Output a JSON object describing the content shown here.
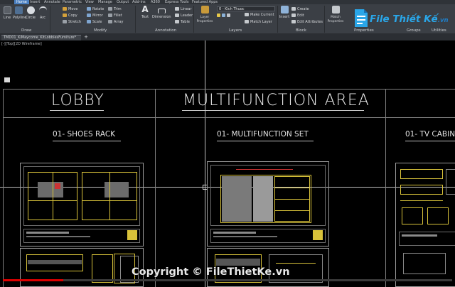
{
  "ribbon": {
    "tabs": [
      "Home",
      "Insert",
      "Annotate",
      "Parametric",
      "View",
      "Manage",
      "Output",
      "Add-ins",
      "A360",
      "Express Tools",
      "Featured Apps"
    ],
    "active_tab": "Home",
    "panels": {
      "draw": "Draw",
      "modify": "Modify",
      "annotation": "Annotation",
      "layers": "Layers",
      "block": "Block",
      "properties": "Properties",
      "groups": "Groups",
      "utilities": "Utilities"
    },
    "draw_tools": {
      "line": "Line",
      "polyline": "Polyline",
      "circle": "Circle",
      "arc": "Arc"
    },
    "modify_tools": {
      "move": "Move",
      "rotate": "Rotate",
      "trim": "Trim",
      "copy": "Copy",
      "mirror": "Mirror",
      "fillet": "Fillet",
      "stretch": "Stretch",
      "scale": "Scale",
      "array": "Array"
    },
    "annotation_tools": {
      "text": "Text",
      "dimension": "Dimension",
      "linear": "Linear",
      "leader": "Leader",
      "table": "Table"
    },
    "layer_tools": {
      "layer_properties": "Layer Properties",
      "make_current": "Make Current",
      "match_layer": "Match Layer",
      "current_layer": "0 - Kich Thuoc"
    },
    "block_tools": {
      "insert": "Insert",
      "create": "Create",
      "edit": "Edit",
      "edit_attributes": "Edit Attributes"
    },
    "properties_tools": {
      "match_properties": "Match Properties"
    }
  },
  "file_tab": {
    "name": "TMD01_KiMaycome_KitLobbiesFurniture*",
    "new_tab": "+"
  },
  "canvas": {
    "viewport_label": "[-][Top][2D Wireframe]",
    "sections": [
      {
        "heading": "LOBBY",
        "subheading": "01- SHOES RACK"
      },
      {
        "heading": "MULTIFUNCTION AREA",
        "subheading": "01- MULTIFUNCTION SET"
      },
      {
        "heading": "",
        "subheading": "01- TV CABINET"
      }
    ]
  },
  "logo": {
    "brand": "File Thiết Kế",
    "tld": ".vn"
  },
  "watermark": "Copyright © FileThietKe.vn",
  "video_progress": 0.135,
  "colors": {
    "ribbon_bg": "#3b3f45",
    "canvas_bg": "#000000",
    "accent": "#4a7fc0",
    "logo_blue": "#2aa6e8",
    "progress_red": "#dd0000",
    "drawing_yellow": "#d8c23a",
    "drawing_gray": "#8a8a8a"
  }
}
